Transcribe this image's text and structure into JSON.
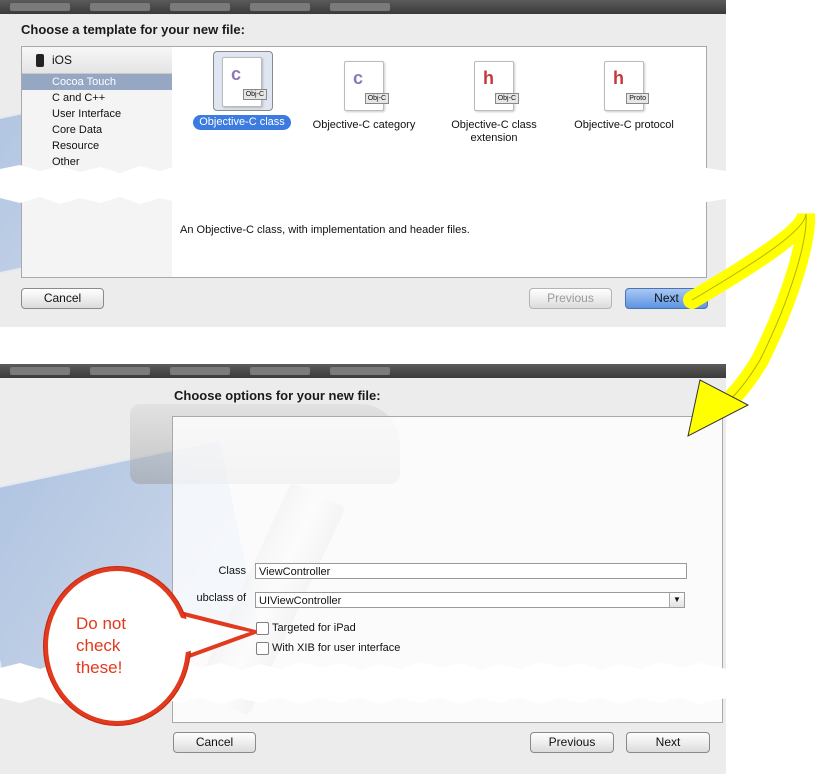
{
  "panel1": {
    "heading": "Choose a template for your new file:",
    "sidebar": {
      "platform": "iOS",
      "items": [
        "Cocoa Touch",
        "C and C++",
        "User Interface",
        "Core Data",
        "Resource",
        "Other"
      ],
      "selected_index": 0
    },
    "templates": [
      {
        "label": "Objective-C class",
        "icon_tag": "Obj-C",
        "icon_letter": "c",
        "selected": true
      },
      {
        "label": "Objective-C category",
        "icon_tag": "Obj-C",
        "icon_letter": "c",
        "selected": false
      },
      {
        "label": "Objective-C class extension",
        "icon_tag": "Obj-C",
        "icon_letter": "h",
        "selected": false
      },
      {
        "label": "Objective-C protocol",
        "icon_tag": "Proto",
        "icon_letter": "h",
        "selected": false
      }
    ],
    "description": "An Objective-C class, with implementation and header files.",
    "buttons": {
      "cancel": "Cancel",
      "previous": "Previous",
      "next": "Next"
    }
  },
  "panel2": {
    "heading": "Choose options for your new file:",
    "fields": {
      "class_label": "Class",
      "class_value": "ViewController",
      "subclass_label": "ubclass of",
      "subclass_value": "UIViewController"
    },
    "checkboxes": [
      {
        "label": "Targeted for iPad",
        "checked": false
      },
      {
        "label": "With XIB for user interface",
        "checked": false
      }
    ],
    "buttons": {
      "cancel": "Cancel",
      "previous": "Previous",
      "next": "Next"
    }
  },
  "callout": {
    "line1": "Do not",
    "line2": "check",
    "line3": "these!",
    "color": "#e23a1e"
  },
  "arrow_color": "#ffff00"
}
